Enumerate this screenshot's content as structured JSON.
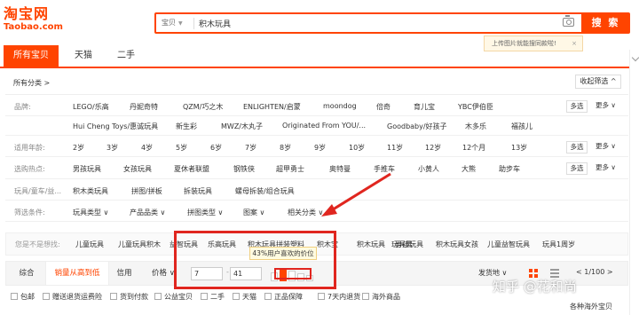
{
  "logo": {
    "cn": "淘宝网",
    "en": "Taobao.com"
  },
  "search": {
    "type": "宝贝",
    "value": "积木玩具",
    "button": "搜 索"
  },
  "upload_tip": {
    "text": "上传图片就能搜同款啦!",
    "close": "×"
  },
  "tabs": [
    "所有宝贝",
    "天猫",
    "二手"
  ],
  "path": "所有分类 >",
  "collapse": "收起筛选 ^",
  "filter_rows": [
    {
      "label": "品牌:",
      "values": [
        "LEGO/乐高",
        "丹妮奇特",
        "QZM/巧之木",
        "ENLIGHTEN/启蒙",
        "moondog",
        "倍奇",
        "育儿宝",
        "YBC伊伯臣"
      ],
      "multi": "多选",
      "more": "更多 ∨"
    },
    {
      "label": "",
      "values": [
        "Hui Cheng Toys/惠诚玩具",
        "新生彩",
        "MWZ/木丸子",
        "Originated From YOU/...",
        "Goodbaby/好孩子",
        "木多乐",
        "福孩儿"
      ]
    },
    {
      "label": "适用年龄:",
      "values": [
        "2岁",
        "3岁",
        "4岁",
        "5岁",
        "6岁",
        "7岁",
        "8岁",
        "9岁",
        "10岁",
        "11岁",
        "12岁",
        "12个月",
        "13岁"
      ],
      "multi": "多选",
      "more": "更多 ∨"
    },
    {
      "label": "选购热点:",
      "values": [
        "男孩玩具",
        "女孩玩具",
        "夏休者联盟",
        "钢铁侠",
        "超甲勇士",
        "奥特曼",
        "手推车",
        "小黄人",
        "大熊",
        "助步车"
      ],
      "multi": "多选",
      "more": "更多 ∨"
    },
    {
      "label": "玩具/童车/益...",
      "values": [
        "积木类玩具",
        "拼图/拼板",
        "拆装玩具",
        "螺母拆装/组合玩具"
      ]
    },
    {
      "label": "筛选条件:",
      "values": [
        "玩具类型 ∨",
        "产品品类 ∨",
        "拼图类型 ∨",
        "图案 ∨",
        "相关分类 ∨"
      ]
    }
  ],
  "related": {
    "label": "您是不是想找:",
    "values": [
      "儿童玩具",
      "儿童玩具积木",
      "益智玩具",
      "乐高玩具",
      "积木玩具拼装塑料",
      "积木宝",
      "积木玩具",
      "玩具男",
      "男孩玩具",
      "积木玩具女孩",
      "儿童益智玩具",
      "玩具1周岁"
    ]
  },
  "sort": {
    "items": [
      "综合",
      "销量从高到低",
      "信用",
      "价格 ∨"
    ],
    "price_from": "7",
    "price_to": "41",
    "dash": "-",
    "ship": "发货地 ∨",
    "pager": "< 1/100 >"
  },
  "price_tip": "43%用户喜欢的价位",
  "checks": [
    "包邮",
    "赠送退货运费险",
    "货到付款",
    "公益宝贝",
    "二手",
    "天猫",
    "正品保障",
    "7天内退货",
    "海外商品"
  ],
  "ship_from": "各种海外宝贝",
  "watermark": "知乎 @花和尚",
  "colors": {
    "brand": "#ff4400",
    "annotation": "#e0261f"
  }
}
